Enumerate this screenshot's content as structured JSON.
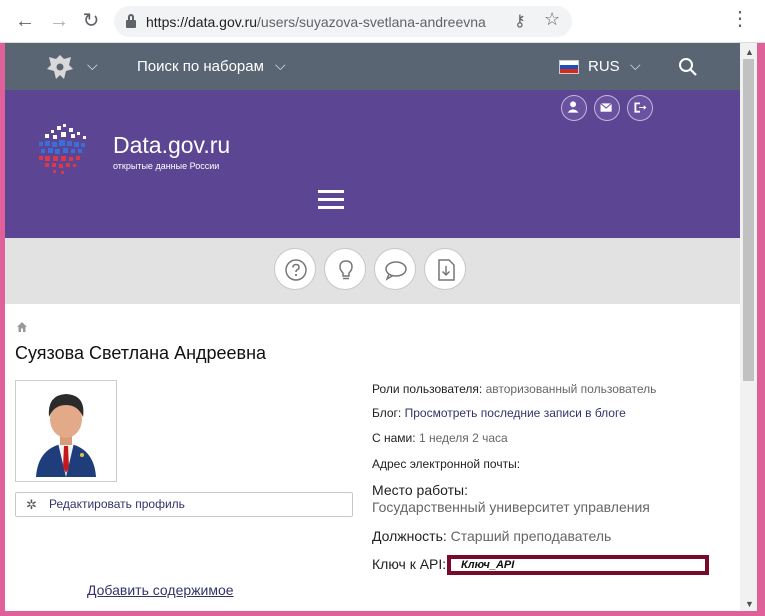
{
  "browser": {
    "url_host": "https://data.gov.ru",
    "url_path": "/users/suyazova-svetlana-andreevna"
  },
  "topbar": {
    "search_sets": "Поиск по наборам",
    "language": "RUS"
  },
  "banner": {
    "title": "Data.gov.ru",
    "subtitle": "открытые данные России"
  },
  "profile": {
    "name": "Суязова Светлана Андреевна",
    "edit_label": "Редактировать профиль",
    "add_content": "Добавить содержимое",
    "roles_label": "Роли пользователя:",
    "roles_value": "авторизованный пользователь",
    "blog_label": "Блог:",
    "blog_link": "Просмотреть последние записи в блоге",
    "with_us_label": "С нами:",
    "with_us_value": "1 неделя 2 часа",
    "email_label": "Адрес электронной почты:",
    "workplace_label": "Место работы:",
    "workplace_value": "Государственный университет управления",
    "position_label": "Должность:",
    "position_value": "Старший преподаватель",
    "api_label": "Ключ к API:",
    "api_value": "Ключ_API"
  },
  "colors": {
    "topbar": "#5a6573",
    "banner": "#5c4592",
    "toolbar": "#e2e2e2",
    "link": "#33336a",
    "api_border": "#7a0a2a"
  },
  "icons": [
    "back-icon",
    "forward-icon",
    "reload-icon",
    "lock-icon",
    "key-icon",
    "star-icon",
    "kebab-menu-icon",
    "emblem-icon",
    "chevron-down-icon",
    "flag-icon",
    "search-icon",
    "user-icon",
    "mail-icon",
    "logout-icon",
    "hamburger-icon",
    "help-icon",
    "idea-icon",
    "comment-icon",
    "download-icon",
    "home-icon",
    "gear-icon"
  ]
}
